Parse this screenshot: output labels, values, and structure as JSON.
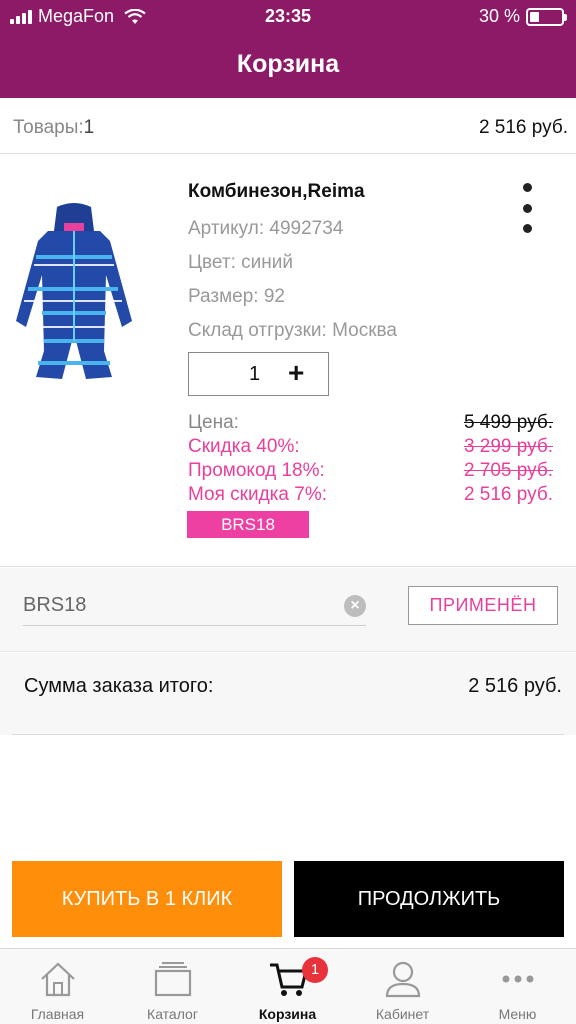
{
  "status_bar": {
    "carrier": "MegaFon",
    "time": "23:35",
    "battery": "30 %",
    "battery_level": 0.3,
    "icons": [
      "signal-icon",
      "wifi-icon",
      "battery-icon"
    ]
  },
  "header": {
    "title": "Корзина"
  },
  "summary": {
    "items_label": "Товары:",
    "items_count": "1",
    "total": "2 516 руб."
  },
  "product": {
    "name": "Комбинезон,Reima",
    "article": "Артикул: 4992734",
    "color": "Цвет: синий",
    "size": "Размер: 92",
    "warehouse": "Склад отгрузки: Москва",
    "quantity": "1",
    "plus_label": "+",
    "prices": {
      "price_label": "Цена:",
      "price_value": "5 499 руб.",
      "discount_label": "Скидка 40%:",
      "discount_value": "3 299 руб.",
      "promo_label": "Промокод 18%:",
      "promo_value": "2 705 руб.",
      "my_discount_label": "Моя скидка 7%:",
      "my_discount_value": "2 516 руб."
    },
    "promo_badge": "BRS18",
    "colors": {
      "pink": "#e8409c",
      "badge_bg": "#ee3fa2"
    }
  },
  "promo": {
    "code": "BRS18",
    "clear_symbol": "×",
    "apply_label": "ПРИМЕНЁН"
  },
  "order_total": {
    "label": "Сумма заказа итого:",
    "value": "2 516 руб."
  },
  "buttons": {
    "buy_one_click": "КУПИТЬ В 1 КЛИК",
    "continue": "ПРОДОЛЖИТЬ",
    "buy_color": "#ff8f0a",
    "continue_color": "#000000"
  },
  "tabbar": {
    "items": [
      {
        "label": "Главная",
        "icon": "home-icon"
      },
      {
        "label": "Каталог",
        "icon": "catalog-icon"
      },
      {
        "label": "Корзина",
        "icon": "cart-icon",
        "badge": "1",
        "active": true
      },
      {
        "label": "Кабинет",
        "icon": "user-icon"
      },
      {
        "label": "Меню",
        "icon": "menu-dots-icon"
      }
    ]
  },
  "theme": {
    "header_bg": "#8c1a66"
  }
}
